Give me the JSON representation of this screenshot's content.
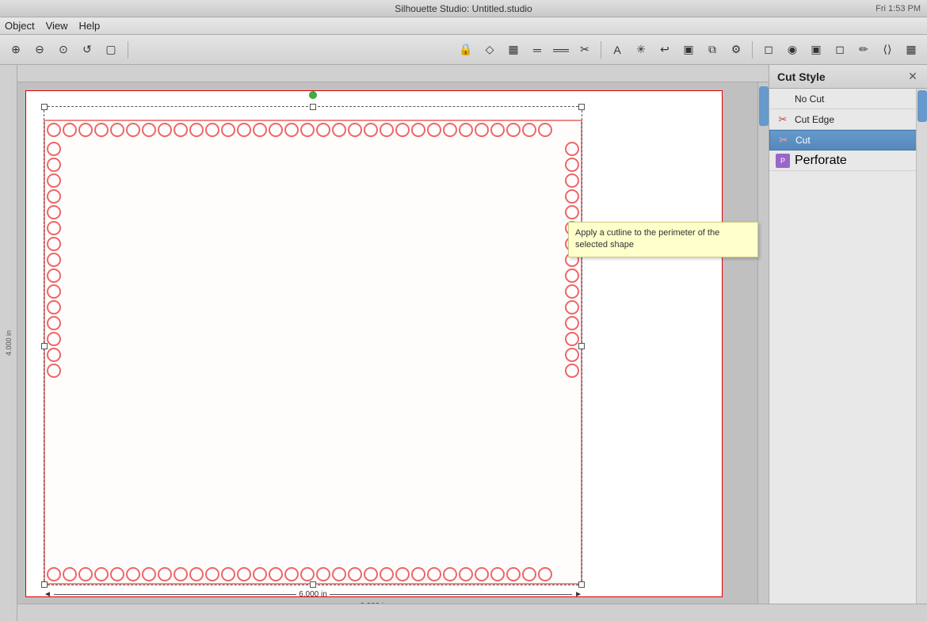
{
  "app": {
    "title": "Silhouette Studio: Untitled.studio",
    "time": "Fri 1:53 PM"
  },
  "menubar": {
    "items": [
      "Object",
      "View",
      "Help"
    ]
  },
  "toolbar": {
    "left_tools": [
      "⊕",
      "⊖",
      "⊙",
      "↺",
      "▢"
    ],
    "right_tools": [
      "🔒",
      "◇",
      "▦",
      "═",
      "══",
      "✂",
      "A",
      "✳",
      "↩",
      "▣",
      "⧉",
      "⚙",
      "◻",
      "◻",
      "◉",
      "▣",
      "◻",
      "✏",
      "⟨⟩",
      "▦"
    ]
  },
  "canvas": {
    "page_width_label": "6.000 in",
    "page_height_label": "4.000 in"
  },
  "cut_style_panel": {
    "title": "Cut Style",
    "items": [
      {
        "id": "no-cut",
        "label": "No Cut",
        "icon": "none",
        "selected": false
      },
      {
        "id": "cut-edge",
        "label": "Cut Edge",
        "icon": "scissors-sm",
        "selected": false
      },
      {
        "id": "cut",
        "label": "Cut",
        "icon": "scissors",
        "selected": true
      },
      {
        "id": "perforate",
        "label": "Perforate",
        "icon": "perf",
        "selected": false
      }
    ],
    "tooltip": {
      "text": "Apply a cutline to the perimeter of the selected shape"
    }
  },
  "icons": {
    "close": "✕",
    "scroll_left": "◀",
    "scroll_right": "▶"
  }
}
